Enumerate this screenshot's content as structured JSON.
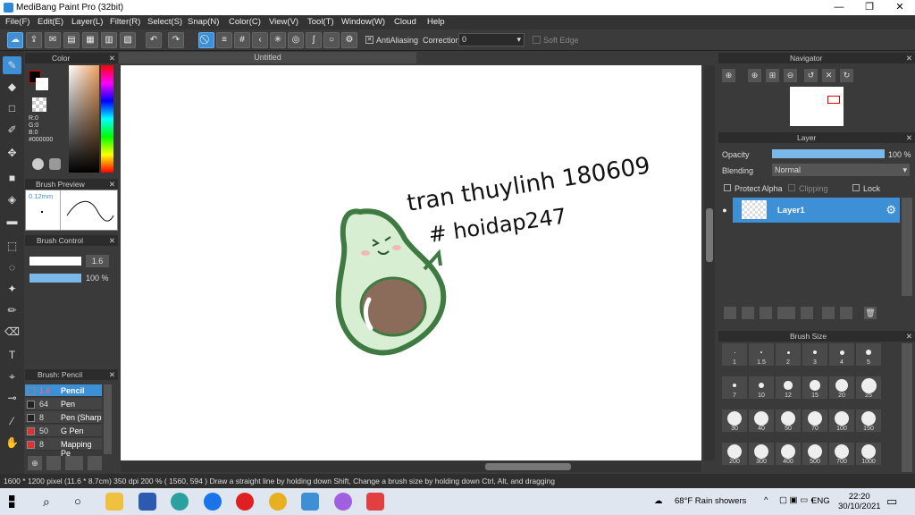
{
  "window": {
    "title": "MediBang Paint Pro (32bit)",
    "min": "—",
    "max": "❐",
    "close": "✕"
  },
  "menu": [
    "File(F)",
    "Edit(E)",
    "Layer(L)",
    "Filter(R)",
    "Select(S)",
    "Snap(N)",
    "Color(C)",
    "View(V)",
    "Tool(T)",
    "Window(W)",
    "Cloud",
    "Help"
  ],
  "toolbar": {
    "antialiasing_label": "AntiAliasing",
    "correction_label": "Correction",
    "correction_value": "0",
    "soft_edge_label": "Soft Edge"
  },
  "color_panel": {
    "title": "Color",
    "r": "R:0",
    "g": "G:0",
    "b": "B:0",
    "hex": "#000000"
  },
  "brush_preview": {
    "title": "Brush Preview",
    "size": "0.12mm"
  },
  "brush_control": {
    "title": "Brush Control",
    "size_value": "1.6",
    "opacity_value": "100 %"
  },
  "brush_list": {
    "title": "Brush: Pencil",
    "items": [
      {
        "size": "1.6",
        "name": "Pencil",
        "color": "#3d8fd6",
        "active": true
      },
      {
        "size": "64",
        "name": "Pen",
        "color": "#222",
        "active": false
      },
      {
        "size": "8",
        "name": "Pen (Sharp",
        "color": "#222",
        "active": false
      },
      {
        "size": "50",
        "name": "G Pen",
        "color": "#e03030",
        "active": false
      },
      {
        "size": "8",
        "name": "Mapping Pe",
        "color": "#e03030",
        "active": false
      }
    ]
  },
  "document": {
    "tab": "Untitled",
    "drawing_text_1": "tran thuylinh 180609",
    "drawing_text_2": "# hoidap247"
  },
  "navigator": {
    "title": "Navigator"
  },
  "layer_panel": {
    "title": "Layer",
    "opacity_label": "Opacity",
    "opacity_value": "100 %",
    "blending_label": "Blending",
    "blending_value": "Normal",
    "protect_alpha": "Protect Alpha",
    "clipping": "Clipping",
    "lock": "Lock",
    "layer_name": "Layer1"
  },
  "brush_size": {
    "title": "Brush Size",
    "row1": [
      "1",
      "1.5",
      "2",
      "3",
      "4",
      "5"
    ],
    "row2": [
      "7",
      "10",
      "12",
      "15",
      "20",
      "25"
    ],
    "row3": [
      "30",
      "40",
      "50",
      "70",
      "100",
      "150"
    ],
    "row4": [
      "200",
      "300",
      "400",
      "500",
      "700",
      "1000"
    ]
  },
  "status": {
    "text": "1600 * 1200 pixel   (11.6 * 8.7cm)   350 dpi   200 %   ( 1560, 594 )   Draw a straight line by holding down Shift, Change a brush size by holding down Ctrl, Alt, and dragging"
  },
  "taskbar": {
    "weather": "68°F  Rain showers",
    "lang": "ENG",
    "time": "22:20",
    "date": "30/10/2021"
  },
  "colors": {
    "accent": "#3d8fd6",
    "panel": "#3a3a3a",
    "avocado_dark": "#3f7a42",
    "avocado_light": "#d8eed3",
    "pit": "#8b6c5a"
  }
}
